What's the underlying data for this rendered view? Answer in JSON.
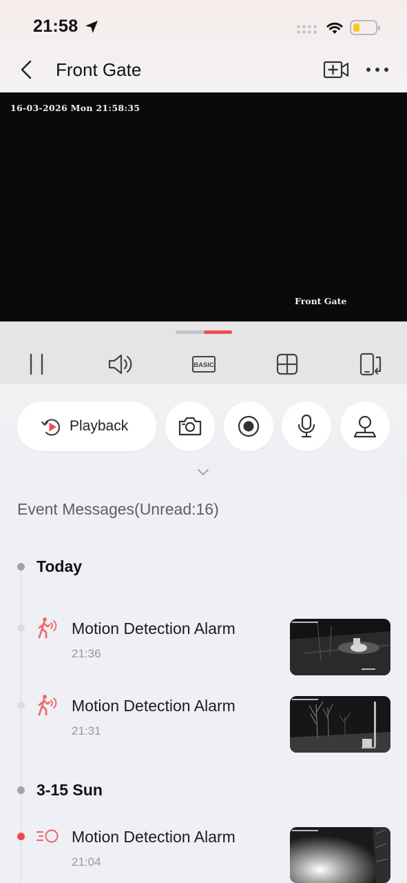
{
  "status_bar": {
    "time": "21:58"
  },
  "nav": {
    "title": "Front Gate"
  },
  "video": {
    "osd_timestamp": "16-03-2026 Mon 21:58:35",
    "osd_camera_name": "Front Gate"
  },
  "controls": {
    "icons": [
      "pause-icon",
      "volume-icon",
      "quality-basic-icon",
      "multi-view-grid-icon",
      "rotate-screen-icon"
    ],
    "quality_label": "BASIC"
  },
  "actions": {
    "playback_label": "Playback",
    "buttons": [
      "snapshot-icon",
      "record-icon",
      "microphone-icon",
      "ptz-icon"
    ]
  },
  "events": {
    "header": "Event Messages(Unread:16)",
    "days": [
      {
        "label": "Today",
        "items": [
          {
            "title": "Motion Detection Alarm",
            "time": "21:36",
            "icon": "motion-person-icon",
            "unread": false
          },
          {
            "title": "Motion Detection Alarm",
            "time": "21:31",
            "icon": "motion-person-icon",
            "unread": false
          }
        ]
      },
      {
        "label": "3-15 Sun",
        "items": [
          {
            "title": "Motion Detection Alarm",
            "time": "21:04",
            "icon": "motion-sensor-icon",
            "unread": true
          }
        ]
      }
    ]
  },
  "colors": {
    "accent": "#f04e51",
    "event_icon": "#f06a6d",
    "background": "#eef0f6"
  }
}
